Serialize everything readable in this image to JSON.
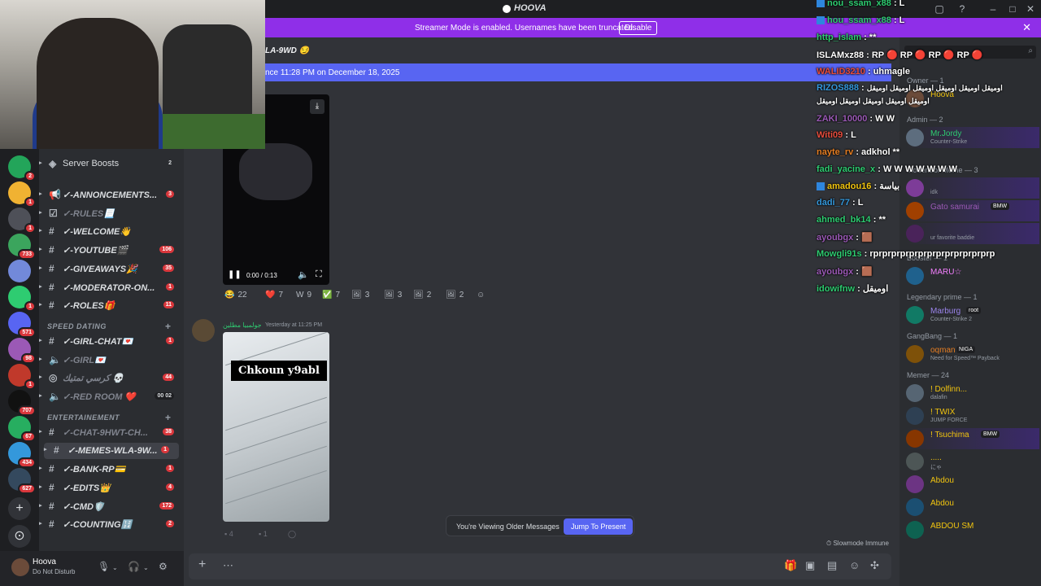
{
  "app": {
    "title": "HOOVA"
  },
  "banner": {
    "text": "Streamer Mode is enabled. Usernames have been truncated.",
    "button": "Disable"
  },
  "channel_header": {
    "name": "LA-9WD 😏"
  },
  "new_messages_bar": {
    "text": "nce 11:28 PM on December 18, 2025"
  },
  "sidebar": {
    "channels": [
      {
        "name": "Server Boosts",
        "count": "2",
        "type": "boost"
      },
      {
        "name": "✓-ANNONCEMENTS...",
        "count": "3",
        "type": "announce"
      },
      {
        "name": "✓-RULES📃",
        "count": "",
        "type": "rules",
        "muted": true
      },
      {
        "name": "✓-WELCOME👋",
        "count": "",
        "type": "text"
      },
      {
        "name": "✓-YOUTUBE🎬",
        "count": "106",
        "type": "text"
      },
      {
        "name": "✓-GIVEAWAYS🎉",
        "count": "35",
        "type": "text"
      },
      {
        "name": "✓-MODERATOR-ON...",
        "count": "1",
        "type": "text"
      },
      {
        "name": "✓-ROLES🎁",
        "count": "11",
        "type": "text"
      }
    ],
    "cat_speed": "SPEED DATING",
    "speed_channels": [
      {
        "name": "✓-GIRL-CHAT💌",
        "count": "1",
        "type": "text"
      },
      {
        "name": "✓-GIRL💌",
        "count": "",
        "type": "voice",
        "muted": true
      },
      {
        "name": "كرسي تمتيك 💀",
        "count": "44",
        "type": "stage",
        "muted": true
      },
      {
        "name": "✓-RED ROOM ❤️",
        "count": "00 02",
        "type": "voice",
        "muted": true
      }
    ],
    "cat_ent": "ENTERTAINEMENT",
    "ent_channels": [
      {
        "name": "✓-CHAT-9HWT-CH...",
        "count": "38",
        "type": "text",
        "muted": true
      },
      {
        "name": "✓-MEMES-WLA-9W...",
        "count": "1",
        "type": "text",
        "active": true
      },
      {
        "name": "✓-BANK-RP💳",
        "count": "1",
        "type": "text"
      },
      {
        "name": "✓-EDITS👑",
        "count": "4",
        "type": "text"
      },
      {
        "name": "✓-CMD🛡️",
        "count": "172",
        "type": "text"
      },
      {
        "name": "✓-COUNTING🔢",
        "count": "2",
        "type": "text"
      }
    ]
  },
  "rail": {
    "badges": [
      "2",
      "1",
      "1",
      "733",
      "",
      "1",
      "571",
      "98",
      "1",
      "707",
      "67",
      "434",
      "627"
    ]
  },
  "user": {
    "name": "Hoova",
    "status": "Do Not Disturb"
  },
  "messages": {
    "msg1": {
      "time": "rday at 11:25 PM",
      "video_time": "0:00 / 0:13"
    },
    "reactions": [
      {
        "emoji": "😂",
        "count": "22"
      },
      {
        "emoji": "❤️",
        "count": "7"
      },
      {
        "emoji": "W",
        "count": "9"
      },
      {
        "emoji": "✅",
        "count": "7"
      },
      {
        "emoji": "🖼",
        "count": "3"
      },
      {
        "emoji": "🖼",
        "count": "3"
      },
      {
        "emoji": "🖼",
        "count": "2"
      },
      {
        "emoji": "🖼",
        "count": "2"
      }
    ],
    "msg2": {
      "author": "جولمبيا مطلين",
      "time": "Yesterday at 11:25 PM",
      "caption": "Chkoun y9abl"
    },
    "msg2_reactions": [
      {
        "count": "4"
      },
      {
        "count": "1"
      }
    ]
  },
  "older_bar": {
    "text": "You're Viewing Older Messages",
    "button": "Jump To Present"
  },
  "slowmode": "Slowmode Immune",
  "members": {
    "owner_label": "Owner — 1",
    "owner": [
      {
        "name": "Hoova",
        "color": "#f1c40f"
      }
    ],
    "admin_label": "Admin — 2",
    "admin": [
      {
        "name": "Mr.Jordy",
        "sub": "Counter-Strike",
        "color": "#2ecc71"
      }
    ],
    "mod_label": "Moderator Meme — 3",
    "mods": [
      {
        "name": "",
        "sub": "idk",
        "color": "#9b59b6"
      },
      {
        "name": "Gato samurai",
        "sub": "",
        "badge": "BMW",
        "color": "#9b59b6"
      },
      {
        "name": "",
        "sub": "ur favorite baddie",
        "color": "#9b59b6"
      }
    ],
    "booster_label": "Booster — 1",
    "booster": [
      {
        "name": "MARU☆",
        "color": "#f47fff"
      }
    ],
    "legendary_label": "Legendary prime — 1",
    "legendary": [
      {
        "name": "Marburg",
        "badge": "root",
        "sub": "Counter-Strike 2",
        "color": "#9b84ec"
      }
    ],
    "gangbang_label": "GangBang — 1",
    "gangbang": [
      {
        "name": "oqman",
        "badge": "NIGA",
        "sub": "Need for Speed™ Payback",
        "color": "#e67e22"
      }
    ],
    "memer_label": "Memer — 24",
    "memers": [
      {
        "name": "! Dolfinn...",
        "sub": "dalafin",
        "color": "#f1c40f"
      },
      {
        "name": "! TWIX",
        "sub": "JUMP FORCE",
        "color": "#f1c40f"
      },
      {
        "name": "! Tsuchima",
        "sub": "",
        "badge": "BMW",
        "color": "#f1c40f"
      },
      {
        "name": ".....",
        "sub": "にゃ",
        "color": "#f1c40f"
      },
      {
        "name": "Abdou",
        "sub": "",
        "color": "#f1c40f"
      },
      {
        "name": "Abdou",
        "sub": "",
        "color": "#f1c40f"
      },
      {
        "name": "ABDOU SM",
        "sub": "",
        "color": "#f1c40f"
      }
    ]
  },
  "twitch_chat": [
    {
      "user": "nou_ssam_x88",
      "msg": "L",
      "color": "#2ecc71",
      "badge": true
    },
    {
      "user": "hou_ssam_x88",
      "msg": "L",
      "color": "#2ecc71",
      "badge": true
    },
    {
      "user": "http_islam",
      "msg": "**",
      "color": "#2ecc71",
      "badge": false
    },
    {
      "user": "ISLAMxz88",
      "msg": "RP 🔴 RP 🔴 RP 🔴 RP 🔴",
      "color": "#ffffff",
      "badge": false
    },
    {
      "user": "WALID3210",
      "msg": "uhmagle",
      "color": "#e74c3c",
      "badge": false
    },
    {
      "user": "RIZOS888",
      "msg": "اوميقل اوميقل اوميقل اوميقل اوميقل اوميقل",
      "color": "#3498db",
      "badge": false
    },
    {
      "user": "",
      "msg": "اوميقل اوميقل اوميقل اوميقل اوميقل",
      "color": "#ffffff",
      "badge": false
    },
    {
      "user": "ZAKI_10000",
      "msg": "W W",
      "color": "#9b59b6",
      "badge": false
    },
    {
      "user": "Witi09",
      "msg": "L",
      "color": "#e74c3c",
      "badge": false
    },
    {
      "user": "nayte_rv",
      "msg": "adkhol **",
      "color": "#e67e22",
      "badge": false
    },
    {
      "user": "fadi_yacine_x",
      "msg": "W W W W W W W",
      "color": "#2ecc71",
      "badge": false
    },
    {
      "user": "amadou16",
      "msg": "بياسة",
      "color": "#f1c40f",
      "badge": true
    },
    {
      "user": "dadi_77",
      "msg": "L",
      "color": "#3498db",
      "badge": false
    },
    {
      "user": "ahmed_bk14",
      "msg": "**",
      "color": "#2ecc71",
      "badge": false
    },
    {
      "user": "ayoubgx",
      "msg": "🟫",
      "color": "#9b59b6",
      "badge": false
    },
    {
      "user": "Mowgli91s",
      "msg": "rprprprprprprprprprprprprprp",
      "color": "#2ecc71",
      "badge": false
    },
    {
      "user": "ayoubgx",
      "msg": "🟫",
      "color": "#9b59b6",
      "badge": false
    },
    {
      "user": "idowifnw",
      "msg": "اوميقل",
      "color": "#2ecc71",
      "badge": false
    }
  ]
}
